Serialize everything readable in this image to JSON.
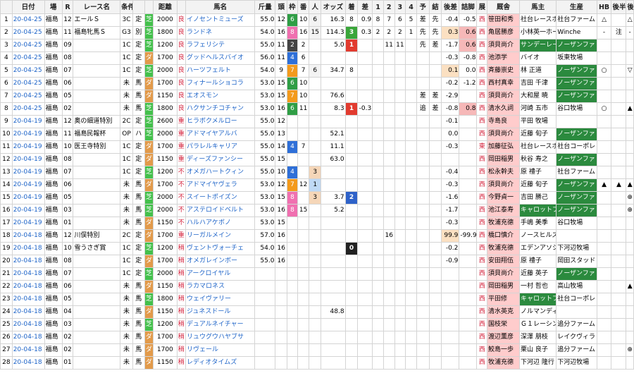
{
  "headers": [
    "日付",
    "場",
    "R",
    "レース名",
    "条件",
    "",
    "",
    "距離",
    "",
    "馬名",
    "斤量",
    "頭",
    "枠",
    "番",
    "人",
    "オッズ",
    "着",
    "差",
    "1",
    "2",
    "3",
    "4",
    "予",
    "結",
    "後差",
    "詰脚",
    "展",
    "厩舎",
    "馬主",
    "生産",
    "HB",
    "後半",
    "後半"
  ],
  "rows": [
    {
      "no": "1",
      "date": "20-04-25",
      "place": "福島",
      "r": "12",
      "race": "エールＳ",
      "grade": "3C",
      "cls": "定",
      "surface": "芝",
      "dist": "2000",
      "cond": "良",
      "mark": "",
      "horse": "イノセントミューズ",
      "kin": "55.0",
      "tou": "12",
      "waku": "6",
      "ban": "10",
      "nin": "6",
      "odds": "16.3",
      "chaku": "8",
      "sa": "0.9",
      "c1": "8",
      "c2": "7",
      "c3": "6",
      "c4": "5",
      "yo": "差",
      "ke": "先",
      "go": "-0.4",
      "tsu": "-0.5",
      "ten": "西",
      "jockey": "笹田和秀",
      "owner": "社台レースホ",
      "breeder": "社台ファーム",
      "hb": "△",
      "k1": "",
      "k2": "△"
    },
    {
      "no": "2",
      "date": "20-04-25",
      "place": "福島",
      "r": "11",
      "race": "福島牝馬Ｓ",
      "grade": "G3",
      "cls": "別",
      "surface": "芝",
      "dist": "1800",
      "cond": "良",
      "mark": "",
      "horse": "ランドネ",
      "kin": "54.0",
      "tou": "16",
      "waku": "8",
      "ban": "16",
      "nin": "15",
      "odds": "114.3",
      "chaku": "3",
      "sa": "0.3",
      "c1": "2",
      "c2": "2",
      "c3": "2",
      "c4": "1",
      "yo": "先",
      "ke": "先",
      "go": "0.3",
      "tsu": "0.6",
      "ten": "西",
      "jockey": "角居勝彦",
      "owner": "小林英一ホー",
      "breeder": "Winche",
      "hb": "-",
      "k1": "注",
      "k2": "-"
    },
    {
      "no": "3",
      "date": "20-04-25",
      "place": "福島",
      "r": "09",
      "race": "",
      "grade": "1C",
      "cls": "定",
      "surface": "芝",
      "dist": "1200",
      "cond": "良",
      "mark": "",
      "horse": "ラフェリシテ",
      "kin": "55.0",
      "tou": "11",
      "waku": "2",
      "ban": "2",
      "nin": "",
      "odds": "5.0",
      "chaku": "1",
      "sa": "",
      "c1": "",
      "c2": "11",
      "c3": "11",
      "c4": "",
      "yo": "先",
      "ke": "差",
      "go": "-1.7",
      "tsu": "0.6",
      "ten": "西",
      "jockey": "須貝尚介",
      "owner": "サンデーレー",
      "breeder": "ノーザンファ",
      "hb": "",
      "k1": "",
      "k2": ""
    },
    {
      "no": "4",
      "date": "20-04-25",
      "place": "福島",
      "r": "08",
      "race": "",
      "grade": "1C",
      "cls": "定",
      "surface": "ダ",
      "dist": "1700",
      "cond": "良",
      "mark": "",
      "horse": "グッドヘルスバイオ",
      "kin": "56.0",
      "tou": "11",
      "waku": "4",
      "ban": "6",
      "nin": "",
      "odds": "",
      "chaku": "",
      "sa": "",
      "c1": "",
      "c2": "",
      "c3": "",
      "c4": "",
      "yo": "",
      "ke": "",
      "go": "-0.3",
      "tsu": "-0.8",
      "ten": "西",
      "jockey": "池添学",
      "owner": "バイオ",
      "breeder": "坂東牧場",
      "hb": "",
      "k1": "",
      "k2": ""
    },
    {
      "no": "5",
      "date": "20-04-25",
      "place": "福島",
      "r": "07",
      "race": "",
      "grade": "1C",
      "cls": "定",
      "surface": "芝",
      "dist": "2000",
      "cond": "良",
      "mark": "",
      "horse": "ハーツフェルト",
      "kin": "54.0",
      "tou": "9",
      "waku": "7",
      "ban": "7",
      "nin": "6",
      "odds": "34.7",
      "chaku": "8",
      "sa": "",
      "c1": "",
      "c2": "",
      "c3": "",
      "c4": "",
      "yo": "",
      "ke": "",
      "go": "0.1",
      "tsu": "0.0",
      "ten": "西",
      "jockey": "斉藤崇史",
      "owner": "林 正道",
      "breeder": "ノーザンファ",
      "hb": "○",
      "k1": "",
      "k2": "▽"
    },
    {
      "no": "6",
      "date": "20-04-25",
      "place": "福島",
      "r": "06",
      "race": "",
      "grade": "未",
      "cls": "馬",
      "surface": "ダ",
      "dist": "1700",
      "cond": "良",
      "mark": "",
      "horse": "フィナールショコラ",
      "kin": "53.0",
      "tou": "15",
      "waku": "6",
      "ban": "10",
      "nin": "",
      "odds": "",
      "chaku": "",
      "sa": "",
      "c1": "",
      "c2": "",
      "c3": "",
      "c4": "",
      "yo": "",
      "ke": "",
      "go": "-0.2",
      "tsu": "-1.2",
      "ten": "西",
      "jockey": "西村真幸",
      "owner": "吉田 千津",
      "breeder": "ノーザンファ",
      "hb": "",
      "k1": "",
      "k2": ""
    },
    {
      "no": "7",
      "date": "20-04-25",
      "place": "福島",
      "r": "05",
      "race": "",
      "grade": "未",
      "cls": "馬",
      "surface": "ダ",
      "dist": "1150",
      "cond": "良",
      "mark": "",
      "horse": "エオスモン",
      "kin": "53.0",
      "tou": "15",
      "waku": "7",
      "ban": "10",
      "nin": "",
      "odds": "76.6",
      "chaku": "",
      "sa": "",
      "c1": "",
      "c2": "",
      "c3": "",
      "c4": "",
      "yo": "差",
      "ke": "差",
      "go": "-2.9",
      "tsu": "",
      "ten": "西",
      "jockey": "須貝尚介",
      "owner": "大和屋 暁",
      "breeder": "ノーザンファ",
      "hb": "",
      "k1": "",
      "k2": ""
    },
    {
      "no": "8",
      "date": "20-04-25",
      "place": "福島",
      "r": "02",
      "race": "",
      "grade": "未",
      "cls": "馬",
      "surface": "芝",
      "dist": "1800",
      "cond": "良",
      "mark": "",
      "horse": "ハクサンチコチャン",
      "kin": "53.0",
      "tou": "16",
      "waku": "6",
      "ban": "11",
      "nin": "",
      "odds": "8.3",
      "chaku": "1",
      "sa": "-0.3",
      "c1": "",
      "c2": "",
      "c3": "",
      "c4": "",
      "yo": "追",
      "ke": "差",
      "go": "-0.8",
      "tsu": "0.8",
      "ten": "西",
      "jockey": "清水久詞",
      "owner": "河崎 五市",
      "breeder": "谷口牧場",
      "hb": "○",
      "k1": "",
      "k2": "▲"
    },
    {
      "no": "9",
      "date": "20-04-19",
      "place": "福島",
      "r": "12",
      "race": "奥の細道特別",
      "grade": "2C",
      "cls": "定",
      "surface": "芝",
      "dist": "2600",
      "cond": "重",
      "mark": "",
      "horse": "ヒラボクメルロー",
      "kin": "55.0",
      "tou": "12",
      "waku": "",
      "ban": "",
      "nin": "",
      "odds": "",
      "chaku": "",
      "sa": "",
      "c1": "",
      "c2": "",
      "c3": "",
      "c4": "",
      "yo": "",
      "ke": "",
      "go": "-0.1",
      "tsu": "",
      "ten": "西",
      "jockey": "寺島良",
      "owner": "平田 牧場",
      "breeder": "",
      "hb": "",
      "k1": "",
      "k2": ""
    },
    {
      "no": "10",
      "date": "20-04-19",
      "place": "福島",
      "r": "11",
      "race": "福島民報杯",
      "grade": "OP",
      "cls": "ハ",
      "surface": "芝",
      "dist": "2000",
      "cond": "重",
      "mark": "",
      "horse": "アドマイヤアルバ",
      "kin": "55.0",
      "tou": "13",
      "waku": "",
      "ban": "",
      "nin": "",
      "odds": "52.1",
      "chaku": "",
      "sa": "",
      "c1": "",
      "c2": "",
      "c3": "",
      "c4": "",
      "yo": "",
      "ke": "",
      "go": "0.0",
      "tsu": "",
      "ten": "西",
      "jockey": "須貝尚介",
      "owner": "近藤 旬子",
      "breeder": "ノーザンファ",
      "hb": "",
      "k1": "",
      "k2": ""
    },
    {
      "no": "11",
      "date": "20-04-19",
      "place": "福島",
      "r": "10",
      "race": "医王寺特別",
      "grade": "1C",
      "cls": "定",
      "surface": "ダ",
      "dist": "1700",
      "cond": "重",
      "mark": "",
      "horse": "パラレルキャリア",
      "kin": "55.0",
      "tou": "14",
      "waku": "4",
      "ban": "7",
      "nin": "",
      "odds": "11.1",
      "chaku": "",
      "sa": "",
      "c1": "",
      "c2": "",
      "c3": "",
      "c4": "",
      "yo": "",
      "ke": "",
      "go": "-0.3",
      "tsu": "",
      "ten": "東",
      "jockey": "加藤征弘",
      "owner": "社台レースホ",
      "breeder": "社台コーポレ",
      "hb": "",
      "k1": "",
      "k2": ""
    },
    {
      "no": "12",
      "date": "20-04-19",
      "place": "福島",
      "r": "08",
      "race": "",
      "grade": "1C",
      "cls": "定",
      "surface": "ダ",
      "dist": "1150",
      "cond": "重",
      "mark": "",
      "horse": "ディーズファンシー",
      "kin": "55.0",
      "tou": "15",
      "waku": "",
      "ban": "",
      "nin": "",
      "odds": "63.0",
      "chaku": "",
      "sa": "",
      "c1": "",
      "c2": "",
      "c3": "",
      "c4": "",
      "yo": "",
      "ke": "",
      "go": "",
      "tsu": "",
      "ten": "西",
      "jockey": "岡田稲男",
      "owner": "秋谷 寿之",
      "breeder": "ノーザンファ",
      "hb": "",
      "k1": "",
      "k2": ""
    },
    {
      "no": "13",
      "date": "20-04-19",
      "place": "福島",
      "r": "07",
      "race": "",
      "grade": "1C",
      "cls": "定",
      "surface": "芝",
      "dist": "1200",
      "cond": "不",
      "mark": "",
      "horse": "オメガハートクィン",
      "kin": "55.0",
      "tou": "10",
      "waku": "4",
      "ban": "",
      "nin": "3",
      "odds": "",
      "chaku": "",
      "sa": "",
      "c1": "",
      "c2": "",
      "c3": "",
      "c4": "",
      "yo": "",
      "ke": "",
      "go": "-0.4",
      "tsu": "",
      "ten": "西",
      "jockey": "松永幹夫",
      "owner": "原 禮子",
      "breeder": "社台ファーム",
      "hb": "",
      "k1": "",
      "k2": ""
    },
    {
      "no": "14",
      "date": "20-04-19",
      "place": "福島",
      "r": "06",
      "race": "",
      "grade": "未",
      "cls": "馬",
      "surface": "ダ",
      "dist": "1700",
      "cond": "不",
      "mark": "",
      "horse": "アドマイヤヴェラ",
      "kin": "53.0",
      "tou": "12",
      "waku": "7",
      "ban": "12",
      "nin": "1",
      "odds": "",
      "chaku": "",
      "sa": "",
      "c1": "",
      "c2": "",
      "c3": "",
      "c4": "",
      "yo": "",
      "ke": "",
      "go": "-0.3",
      "tsu": "",
      "ten": "西",
      "jockey": "須貝尚介",
      "owner": "近藤 旬子",
      "breeder": "ノーザンファ",
      "hb": "▲",
      "k1": "▲",
      "k2": "▲"
    },
    {
      "no": "15",
      "date": "20-04-19",
      "place": "福島",
      "r": "05",
      "race": "",
      "grade": "未",
      "cls": "馬",
      "surface": "芝",
      "dist": "2000",
      "cond": "不",
      "mark": "",
      "horse": "スイートポイズン",
      "kin": "53.0",
      "tou": "15",
      "waku": "8",
      "ban": "",
      "nin": "3",
      "odds": "3.7",
      "chaku": "2",
      "sa": "",
      "c1": "",
      "c2": "",
      "c3": "",
      "c4": "",
      "yo": "",
      "ke": "",
      "go": "-1.6",
      "tsu": "",
      "ten": "西",
      "jockey": "今野貞一",
      "owner": "吉田 勝己",
      "breeder": "ノーザンファ",
      "hb": "",
      "k1": "",
      "k2": "⊕"
    },
    {
      "no": "16",
      "date": "20-04-19",
      "place": "福島",
      "r": "03",
      "race": "",
      "grade": "未",
      "cls": "馬",
      "surface": "芝",
      "dist": "2000",
      "cond": "不",
      "mark": "",
      "horse": "アステロイドベルト",
      "kin": "53.0",
      "tou": "16",
      "waku": "8",
      "ban": "15",
      "nin": "",
      "odds": "5.2",
      "chaku": "",
      "sa": "",
      "c1": "",
      "c2": "",
      "c3": "",
      "c4": "",
      "yo": "",
      "ke": "",
      "go": "-1.7",
      "tsu": "",
      "ten": "西",
      "jockey": "池江泰寿",
      "owner": "キャロットフ",
      "breeder": "ノーザンファ",
      "hb": "",
      "k1": "",
      "k2": "⊕"
    },
    {
      "no": "17",
      "date": "20-04-19",
      "place": "福島",
      "r": "01",
      "race": "",
      "grade": "未",
      "cls": "馬",
      "surface": "ダ",
      "dist": "1150",
      "cond": "不",
      "mark": "",
      "horse": "ハルハアケボノ",
      "kin": "53.0",
      "tou": "15",
      "waku": "",
      "ban": "",
      "nin": "",
      "odds": "",
      "chaku": "",
      "sa": "",
      "c1": "",
      "c2": "",
      "c3": "",
      "c4": "",
      "yo": "",
      "ke": "",
      "go": "-0.3",
      "tsu": "",
      "ten": "西",
      "jockey": "牧浦充德",
      "owner": "手嶋 美季",
      "breeder": "谷口牧場",
      "hb": "",
      "k1": "",
      "k2": ""
    },
    {
      "no": "18",
      "date": "20-04-18",
      "place": "福島",
      "r": "12",
      "race": "川俣特別",
      "grade": "2C",
      "cls": "定",
      "surface": "ダ",
      "dist": "1700",
      "cond": "重",
      "mark": "",
      "horse": "リーガルメイン",
      "kin": "57.0",
      "tou": "16",
      "waku": "",
      "ban": "",
      "nin": "",
      "odds": "",
      "chaku": "",
      "sa": "",
      "c1": "",
      "c2": "16",
      "c3": "",
      "c4": "",
      "yo": "",
      "ke": "",
      "go": "99.9",
      "tsu": "-99.9",
      "ten": "西",
      "jockey": "橋口慎介",
      "owner": "ノースヒルズ",
      "breeder": "",
      "hb": "",
      "k1": "",
      "k2": ""
    },
    {
      "no": "19",
      "date": "20-04-18",
      "place": "福島",
      "r": "10",
      "race": "雪うさぎ賞",
      "grade": "1C",
      "cls": "定",
      "surface": "芝",
      "dist": "1200",
      "cond": "稍",
      "mark": "",
      "horse": "ヴェントヴォーチェ",
      "kin": "54.0",
      "tou": "16",
      "waku": "",
      "ban": "",
      "nin": "",
      "odds": "",
      "chaku": "0",
      "sa": "",
      "c1": "",
      "c2": "",
      "c3": "",
      "c4": "",
      "yo": "",
      "ke": "",
      "go": "-0.2",
      "tsu": "",
      "ten": "西",
      "jockey": "牧浦充德",
      "owner": "エデンアソシ",
      "breeder": "下河辺牧場",
      "hb": "",
      "k1": "",
      "k2": ""
    },
    {
      "no": "20",
      "date": "20-04-18",
      "place": "福島",
      "r": "08",
      "race": "",
      "grade": "1C",
      "cls": "定",
      "surface": "ダ",
      "dist": "1700",
      "cond": "稍",
      "mark": "",
      "horse": "オメガレインボー",
      "kin": "55.0",
      "tou": "16",
      "waku": "",
      "ban": "",
      "nin": "",
      "odds": "",
      "chaku": "",
      "sa": "",
      "c1": "",
      "c2": "",
      "c3": "",
      "c4": "",
      "yo": "",
      "ke": "",
      "go": "-0.9",
      "tsu": "",
      "ten": "西",
      "jockey": "安田翔伍",
      "owner": "原 禮子",
      "breeder": "岡田スタッド",
      "hb": "",
      "k1": "",
      "k2": ""
    },
    {
      "no": "21",
      "date": "20-04-18",
      "place": "福島",
      "r": "07",
      "race": "",
      "grade": "1C",
      "cls": "定",
      "surface": "芝",
      "dist": "2000",
      "cond": "稍",
      "mark": "",
      "horse": "アークロイヤル",
      "kin": "",
      "tou": "",
      "waku": "",
      "ban": "",
      "nin": "",
      "odds": "",
      "chaku": "",
      "sa": "",
      "c1": "",
      "c2": "",
      "c3": "",
      "c4": "",
      "yo": "",
      "ke": "",
      "go": "",
      "tsu": "",
      "ten": "西",
      "jockey": "須貝尚介",
      "owner": "近藤 英子",
      "breeder": "ノーザンファ",
      "hb": "",
      "k1": "",
      "k2": ""
    },
    {
      "no": "22",
      "date": "20-04-18",
      "place": "福島",
      "r": "06",
      "race": "",
      "grade": "未",
      "cls": "馬",
      "surface": "ダ",
      "dist": "1150",
      "cond": "稍",
      "mark": "",
      "horse": "ラカマロネス",
      "kin": "",
      "tou": "",
      "waku": "",
      "ban": "",
      "nin": "",
      "odds": "",
      "chaku": "",
      "sa": "",
      "c1": "",
      "c2": "",
      "c3": "",
      "c4": "",
      "yo": "",
      "ke": "",
      "go": "",
      "tsu": "",
      "ten": "西",
      "jockey": "岡田稲男",
      "owner": "一村 哲也",
      "breeder": "高山牧場",
      "hb": "",
      "k1": "",
      "k2": "▲"
    },
    {
      "no": "23",
      "date": "20-04-18",
      "place": "福島",
      "r": "05",
      "race": "",
      "grade": "未",
      "cls": "馬",
      "surface": "芝",
      "dist": "1800",
      "cond": "稍",
      "mark": "",
      "horse": "ウェイヴァリー",
      "kin": "",
      "tou": "",
      "waku": "",
      "ban": "",
      "nin": "",
      "odds": "",
      "chaku": "",
      "sa": "",
      "c1": "",
      "c2": "",
      "c3": "",
      "c4": "",
      "yo": "",
      "ke": "",
      "go": "",
      "tsu": "",
      "ten": "西",
      "jockey": "平田修",
      "owner": "キャロットフ",
      "breeder": "社台コーポレ",
      "hb": "",
      "k1": "",
      "k2": ""
    },
    {
      "no": "24",
      "date": "20-04-18",
      "place": "福島",
      "r": "04",
      "race": "",
      "grade": "未",
      "cls": "馬",
      "surface": "ダ",
      "dist": "1150",
      "cond": "稍",
      "mark": "",
      "horse": "ジュネスドール",
      "kin": "",
      "tou": "",
      "waku": "",
      "ban": "",
      "nin": "",
      "odds": "48.8",
      "chaku": "",
      "sa": "",
      "c1": "",
      "c2": "",
      "c3": "",
      "c4": "",
      "yo": "",
      "ke": "",
      "go": "",
      "tsu": "",
      "ten": "西",
      "jockey": "清水英克",
      "owner": "ノルマンディ",
      "breeder": "",
      "hb": "",
      "k1": "",
      "k2": ""
    },
    {
      "no": "25",
      "date": "20-04-18",
      "place": "福島",
      "r": "03",
      "race": "",
      "grade": "未",
      "cls": "馬",
      "surface": "芝",
      "dist": "1200",
      "cond": "稍",
      "mark": "",
      "horse": "デュアルネイチャー",
      "kin": "",
      "tou": "",
      "waku": "",
      "ban": "",
      "nin": "",
      "odds": "",
      "chaku": "",
      "sa": "",
      "c1": "",
      "c2": "",
      "c3": "",
      "c4": "",
      "yo": "",
      "ke": "",
      "go": "",
      "tsu": "",
      "ten": "西",
      "jockey": "国枝栄",
      "owner": "Ｇ１レーシン",
      "breeder": "追分ファーム",
      "hb": "",
      "k1": "",
      "k2": ""
    },
    {
      "no": "26",
      "date": "20-04-18",
      "place": "福島",
      "r": "02",
      "race": "",
      "grade": "未",
      "cls": "馬",
      "surface": "ダ",
      "dist": "1700",
      "cond": "稍",
      "mark": "",
      "horse": "リュウグウハヤブサ",
      "kin": "",
      "tou": "",
      "waku": "",
      "ban": "",
      "nin": "",
      "odds": "",
      "chaku": "",
      "sa": "",
      "c1": "",
      "c2": "",
      "c3": "",
      "c4": "",
      "yo": "",
      "ke": "",
      "go": "",
      "tsu": "",
      "ten": "西",
      "jockey": "渡辺薫彦",
      "owner": "深澤 朋枝",
      "breeder": "レイクヴィラ",
      "hb": "",
      "k1": "",
      "k2": ""
    },
    {
      "no": "27",
      "date": "20-04-18",
      "place": "福島",
      "r": "02",
      "race": "",
      "grade": "未",
      "cls": "馬",
      "surface": "ダ",
      "dist": "1700",
      "cond": "稍",
      "mark": "",
      "horse": "リヴェール",
      "kin": "",
      "tou": "",
      "waku": "",
      "ban": "",
      "nin": "",
      "odds": "",
      "chaku": "",
      "sa": "",
      "c1": "",
      "c2": "",
      "c3": "",
      "c4": "",
      "yo": "",
      "ke": "",
      "go": "",
      "tsu": "",
      "ten": "西",
      "jockey": "鮫島一歩",
      "owner": "栗山 良子",
      "breeder": "追分ファーム",
      "hb": "",
      "k1": "",
      "k2": "⊕"
    },
    {
      "no": "28",
      "date": "20-04-18",
      "place": "福島",
      "r": "01",
      "race": "",
      "grade": "未",
      "cls": "馬",
      "surface": "ダ",
      "dist": "1150",
      "cond": "稍",
      "mark": "",
      "horse": "レディオタイムズ",
      "kin": "",
      "tou": "",
      "waku": "",
      "ban": "",
      "nin": "",
      "odds": "",
      "chaku": "",
      "sa": "",
      "c1": "",
      "c2": "",
      "c3": "",
      "c4": "",
      "yo": "",
      "ke": "",
      "go": "",
      "tsu": "",
      "ten": "西",
      "jockey": "牧浦充德",
      "owner": "下河辺 隆行",
      "breeder": "下河辺牧場",
      "hb": "",
      "k1": "",
      "k2": ""
    }
  ],
  "colors": {
    "turf": "#44c04c",
    "dirt": "#e29a4a",
    "jockey_bg": "#ffcccc",
    "link": "#1e64c8",
    "owner_highlight": "#2b8a3e"
  }
}
